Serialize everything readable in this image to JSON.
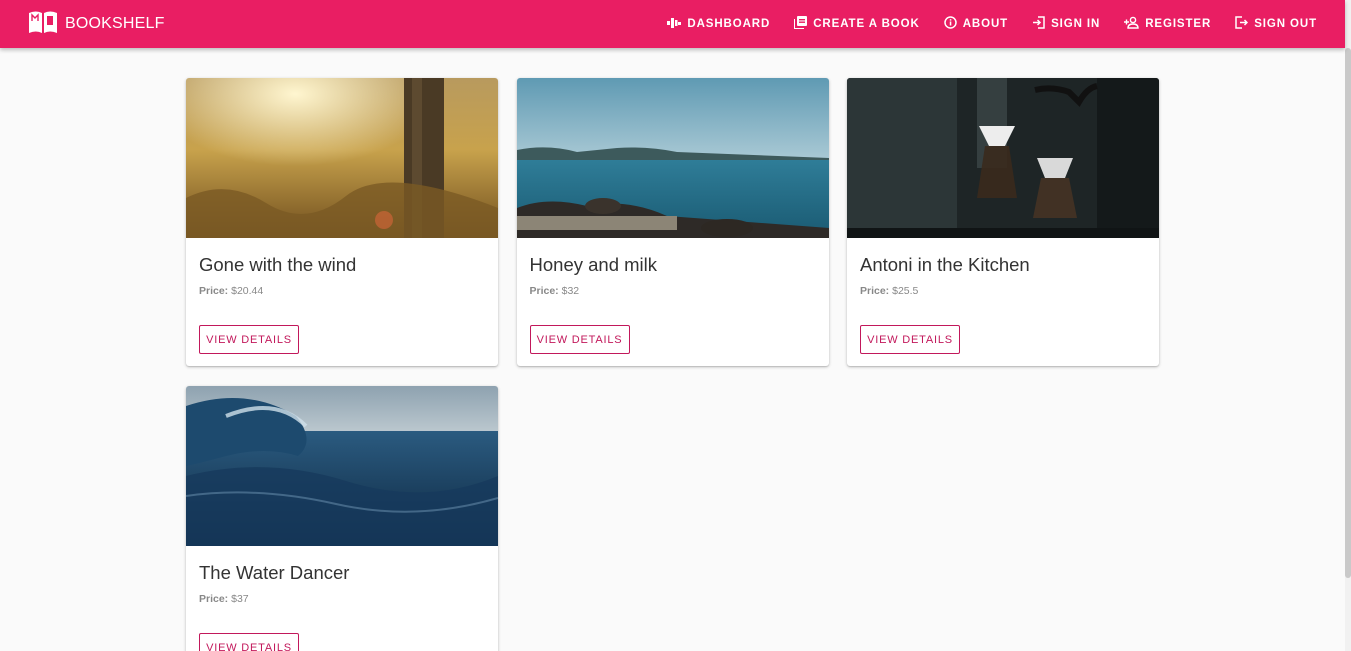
{
  "app": {
    "brand_title": "BOOKSHELF",
    "accent_color": "#e91e63",
    "button_color": "#c2185b"
  },
  "nav": {
    "items": [
      {
        "label": "DASHBOARD",
        "icon": "dashboard-icon"
      },
      {
        "label": "CREATE A BOOK",
        "icon": "library-add-icon"
      },
      {
        "label": "ABOUT",
        "icon": "info-icon"
      },
      {
        "label": "SIGN IN",
        "icon": "login-icon"
      },
      {
        "label": "REGISTER",
        "icon": "person-add-icon"
      },
      {
        "label": "SIGN OUT",
        "icon": "logout-icon"
      }
    ]
  },
  "books": [
    {
      "title": "Gone with the wind",
      "price_label": "Price:",
      "price": "$20.44",
      "button": "VIEW DETAILS",
      "image": "sunlit-meadow-with-tree"
    },
    {
      "title": "Honey and milk",
      "price_label": "Price:",
      "price": "$32",
      "button": "VIEW DETAILS",
      "image": "lake-shore-with-rocks"
    },
    {
      "title": "Antoni in the Kitchen",
      "price_label": "Price:",
      "price": "$25.5",
      "button": "VIEW DETAILS",
      "image": "pour-over-coffee-bar"
    },
    {
      "title": "The Water Dancer",
      "price_label": "Price:",
      "price": "$37",
      "button": "VIEW DETAILS",
      "image": "ocean-wave"
    }
  ]
}
